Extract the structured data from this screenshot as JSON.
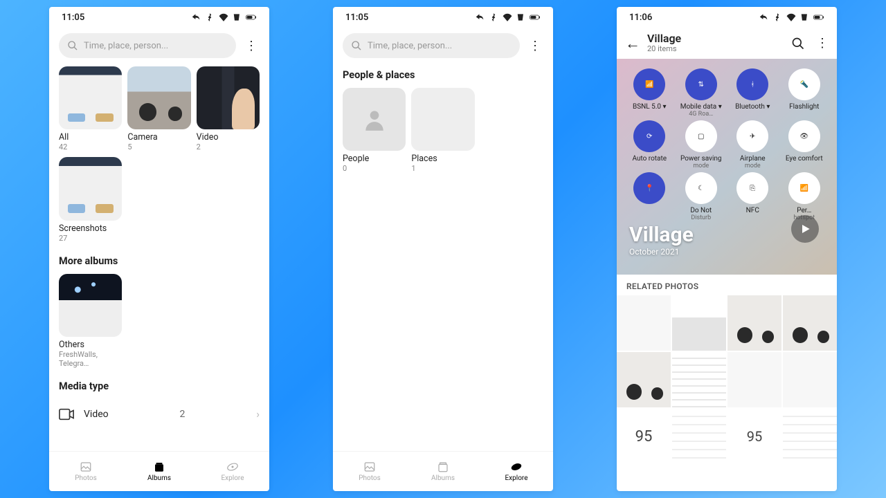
{
  "status": {
    "time1": "11:05",
    "time2": "11:05",
    "time3": "11:06"
  },
  "search": {
    "placeholder": "Time, place, person..."
  },
  "albums": [
    {
      "name": "All",
      "count": "42"
    },
    {
      "name": "Camera",
      "count": "5"
    },
    {
      "name": "Video",
      "count": "2"
    },
    {
      "name": "Screenshots",
      "count": "27"
    }
  ],
  "moreAlbumsTitle": "More albums",
  "moreAlbums": [
    {
      "name": "Others",
      "sub": "FreshWalls, Telegra…"
    }
  ],
  "mediaTypeTitle": "Media type",
  "mediaRows": [
    {
      "label": "Video",
      "count": "2"
    }
  ],
  "nav": {
    "photos": "Photos",
    "albums": "Albums",
    "explore": "Explore"
  },
  "exploreSection": "People & places",
  "exploreItems": [
    {
      "name": "People",
      "count": "0"
    },
    {
      "name": "Places",
      "count": "1"
    }
  ],
  "screen3": {
    "title": "Village",
    "subtitle": "20 items",
    "heroTitle": "Village",
    "heroDate": "October 2021",
    "relatedHdr": "RELATED PHOTOS"
  },
  "qs": [
    {
      "label": "BSNL 5.0",
      "sub": "",
      "on": true
    },
    {
      "label": "Mobile data",
      "sub": "4G   Roa…",
      "on": true
    },
    {
      "label": "Bluetooth",
      "sub": "",
      "on": true
    },
    {
      "label": "Flashlight",
      "sub": "",
      "on": false
    },
    {
      "label": "Auto rotate",
      "sub": "",
      "on": true
    },
    {
      "label": "Power saving",
      "sub": "mode",
      "on": false
    },
    {
      "label": "Airplane",
      "sub": "mode",
      "on": false
    },
    {
      "label": "Eye comfort",
      "sub": "",
      "on": false
    },
    {
      "label": "",
      "sub": "",
      "on": true
    },
    {
      "label": "Do Not",
      "sub": "Disturb",
      "on": false
    },
    {
      "label": "NFC",
      "sub": "",
      "on": false
    },
    {
      "label": "Per…",
      "sub": "hotspot",
      "on": false
    }
  ],
  "bigNumber": "95"
}
